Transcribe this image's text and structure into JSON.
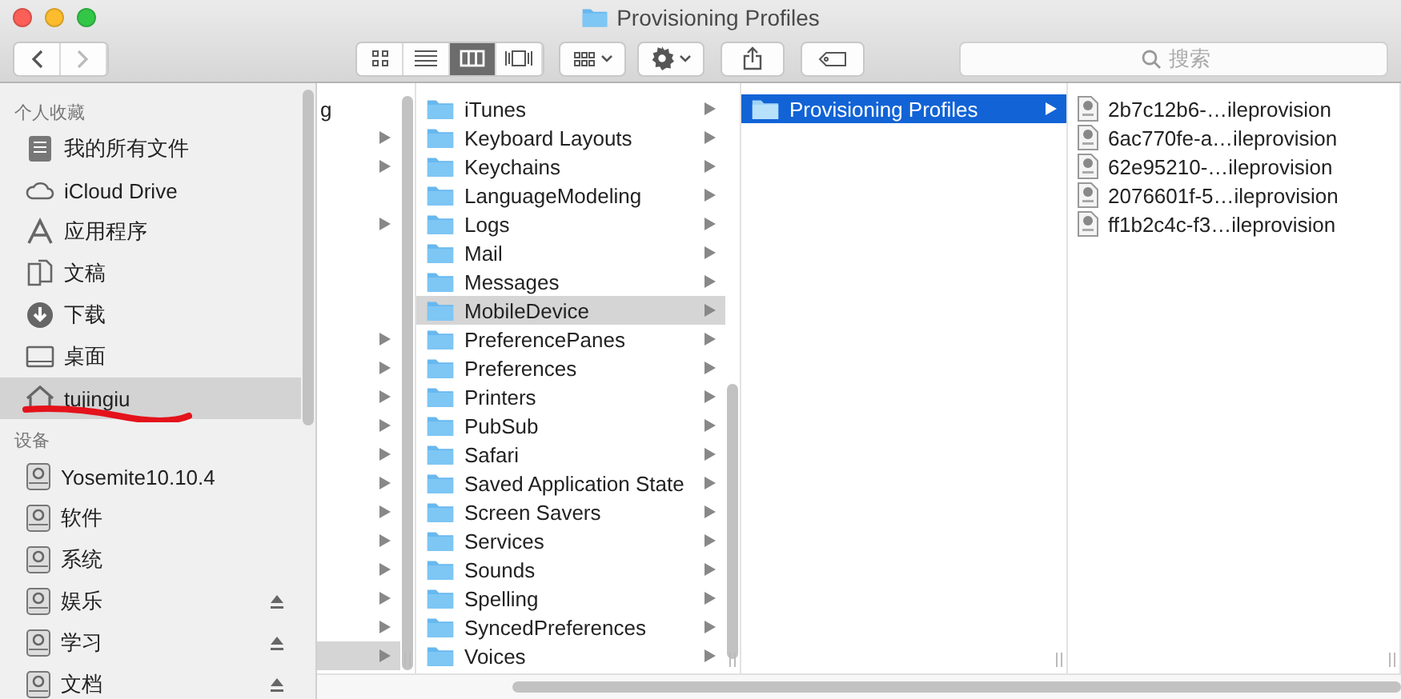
{
  "window": {
    "title": "Provisioning Profiles"
  },
  "toolbar": {
    "views": [
      {
        "kind": "icons",
        "selected": false
      },
      {
        "kind": "list",
        "selected": false
      },
      {
        "kind": "columns",
        "selected": true
      },
      {
        "kind": "coverflow",
        "selected": false
      }
    ],
    "search": {
      "placeholder": "搜索"
    }
  },
  "sidebar": {
    "sections": [
      {
        "heading": "个人收藏",
        "items": [
          {
            "label": "我的所有文件",
            "kind": "allfiles",
            "selected": false,
            "eject": false
          },
          {
            "label": "iCloud Drive",
            "kind": "cloud",
            "selected": false,
            "eject": false
          },
          {
            "label": "应用程序",
            "kind": "apps",
            "selected": false,
            "eject": false
          },
          {
            "label": "文稿",
            "kind": "docs",
            "selected": false,
            "eject": false
          },
          {
            "label": "下载",
            "kind": "download",
            "selected": false,
            "eject": false
          },
          {
            "label": "桌面",
            "kind": "desktop",
            "selected": false,
            "eject": false
          },
          {
            "label": "tujingiu",
            "kind": "home",
            "selected": true,
            "eject": false,
            "scribbled": true
          }
        ]
      },
      {
        "heading": "设备",
        "items": [
          {
            "label": "Yosemite10.10.4",
            "kind": "disk",
            "selected": false,
            "eject": false
          },
          {
            "label": "软件",
            "kind": "disk",
            "selected": false,
            "eject": false
          },
          {
            "label": "系统",
            "kind": "disk",
            "selected": false,
            "eject": false
          },
          {
            "label": "娱乐",
            "kind": "disk",
            "selected": false,
            "eject": true
          },
          {
            "label": "学习",
            "kind": "disk",
            "selected": false,
            "eject": true
          },
          {
            "label": "文档",
            "kind": "disk",
            "selected": false,
            "eject": true
          }
        ]
      }
    ]
  },
  "columns": [
    {
      "focused": false,
      "rows": [
        {
          "kind": "cut",
          "name": "g",
          "arrow": false,
          "selected": false
        },
        {
          "kind": "cut",
          "arrow": true,
          "selected": false
        },
        {
          "kind": "cut",
          "arrow": true,
          "selected": false
        },
        {
          "kind": "blank"
        },
        {
          "kind": "cut",
          "arrow": true,
          "selected": false
        },
        {
          "kind": "blank"
        },
        {
          "kind": "blank"
        },
        {
          "kind": "blank"
        },
        {
          "kind": "cut",
          "arrow": true,
          "selected": false
        },
        {
          "kind": "cut",
          "arrow": true,
          "selected": false
        },
        {
          "kind": "cut",
          "arrow": true,
          "selected": false
        },
        {
          "kind": "cut",
          "arrow": true,
          "selected": false
        },
        {
          "kind": "cut",
          "arrow": true,
          "selected": false
        },
        {
          "kind": "cut",
          "arrow": true,
          "selected": false
        },
        {
          "kind": "cut",
          "arrow": true,
          "selected": false
        },
        {
          "kind": "cut",
          "arrow": true,
          "selected": false
        },
        {
          "kind": "cut",
          "arrow": true,
          "selected": false
        },
        {
          "kind": "cut",
          "arrow": true,
          "selected": false
        },
        {
          "kind": "cut",
          "arrow": true,
          "selected": false
        },
        {
          "kind": "cut",
          "arrow": true,
          "selected": true
        }
      ]
    },
    {
      "focused": false,
      "rows": [
        {
          "kind": "folder",
          "name": "iTunes",
          "arrow": true,
          "selected": false
        },
        {
          "kind": "folder",
          "name": "Keyboard Layouts",
          "arrow": true,
          "selected": false
        },
        {
          "kind": "folder",
          "name": "Keychains",
          "arrow": true,
          "selected": false
        },
        {
          "kind": "folder",
          "name": "LanguageModeling",
          "arrow": true,
          "selected": false
        },
        {
          "kind": "folder",
          "name": "Logs",
          "arrow": true,
          "selected": false
        },
        {
          "kind": "folder",
          "name": "Mail",
          "arrow": true,
          "selected": false
        },
        {
          "kind": "folder",
          "name": "Messages",
          "arrow": true,
          "selected": false
        },
        {
          "kind": "folder",
          "name": "MobileDevice",
          "arrow": true,
          "selected": true
        },
        {
          "kind": "folder",
          "name": "PreferencePanes",
          "arrow": true,
          "selected": false
        },
        {
          "kind": "folder",
          "name": "Preferences",
          "arrow": true,
          "selected": false
        },
        {
          "kind": "folder",
          "name": "Printers",
          "arrow": true,
          "selected": false
        },
        {
          "kind": "folder",
          "name": "PubSub",
          "arrow": true,
          "selected": false
        },
        {
          "kind": "folder",
          "name": "Safari",
          "arrow": true,
          "selected": false
        },
        {
          "kind": "folder",
          "name": "Saved Application State",
          "arrow": true,
          "selected": false
        },
        {
          "kind": "folder",
          "name": "Screen Savers",
          "arrow": true,
          "selected": false
        },
        {
          "kind": "folder",
          "name": "Services",
          "arrow": true,
          "selected": false
        },
        {
          "kind": "folder",
          "name": "Sounds",
          "arrow": true,
          "selected": false
        },
        {
          "kind": "folder",
          "name": "Spelling",
          "arrow": true,
          "selected": false
        },
        {
          "kind": "folder",
          "name": "SyncedPreferences",
          "arrow": true,
          "selected": false
        },
        {
          "kind": "folder",
          "name": "Voices",
          "arrow": true,
          "selected": false
        }
      ]
    },
    {
      "focused": true,
      "rows": [
        {
          "kind": "folder",
          "name": "Provisioning Profiles",
          "arrow": true,
          "selected": true
        }
      ]
    },
    {
      "rows": [
        {
          "kind": "file",
          "name": "2b7c12b6-…ileprovision",
          "arrow": false,
          "selected": false
        },
        {
          "kind": "file",
          "name": "6ac770fe-a…ileprovision",
          "arrow": false,
          "selected": false
        },
        {
          "kind": "file",
          "name": "62e95210-…ileprovision",
          "arrow": false,
          "selected": false
        },
        {
          "kind": "file",
          "name": "2076601f-5…ileprovision",
          "arrow": false,
          "selected": false
        },
        {
          "kind": "file",
          "name": "ff1b2c4c-f3…ileprovision",
          "arrow": false,
          "selected": false
        }
      ]
    }
  ]
}
